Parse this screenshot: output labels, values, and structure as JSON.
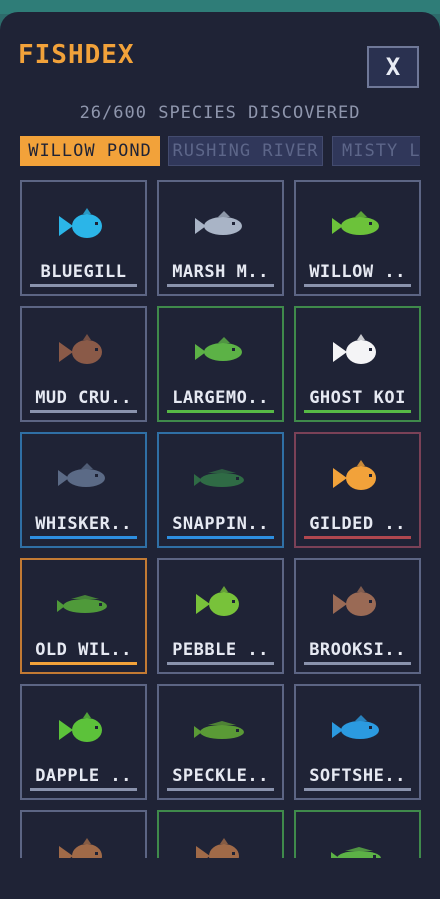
{
  "header": {
    "title": "FISHDEX",
    "close_label": "X"
  },
  "progress_text": "26/600 SPECIES DISCOVERED",
  "tabs": [
    {
      "label": "WILLOW POND",
      "active": true
    },
    {
      "label": "RUSHING RIVER",
      "active": false
    },
    {
      "label": "MISTY LA",
      "active": false
    }
  ],
  "colors": {
    "accent": "#f2a23a",
    "panel": "#1f2336",
    "common": "#8a93ad",
    "uncommon": "#56b845",
    "rare": "#2d8ee0",
    "epic": "#b0474f",
    "legendary": "#f2a23a"
  },
  "fish": [
    {
      "label": "BLUEGILL",
      "rarity": "common",
      "color": "#2bb5e8",
      "shape": "round"
    },
    {
      "label": "MARSH M..",
      "rarity": "common",
      "color": "#a9b4c6",
      "shape": "long"
    },
    {
      "label": "WILLOW ..",
      "rarity": "common",
      "color": "#6cc23a",
      "shape": "long"
    },
    {
      "label": "MUD CRU..",
      "rarity": "common",
      "color": "#8a5a48",
      "shape": "round"
    },
    {
      "label": "LARGEMO..",
      "rarity": "uncommon",
      "color": "#5cb246",
      "shape": "long"
    },
    {
      "label": "GHOST KOI",
      "rarity": "uncommon",
      "color": "#f4f4f6",
      "shape": "round"
    },
    {
      "label": "WHISKER..",
      "rarity": "rare",
      "color": "#5b6a86",
      "shape": "long"
    },
    {
      "label": "SNAPPIN..",
      "rarity": "rare",
      "color": "#2f6b45",
      "shape": "flat"
    },
    {
      "label": "GILDED ..",
      "rarity": "epic",
      "color": "#f2a23a",
      "shape": "round"
    },
    {
      "label": "OLD WIL..",
      "rarity": "legendary",
      "color": "#4f9a3a",
      "shape": "flat"
    },
    {
      "label": "PEBBLE ..",
      "rarity": "common",
      "color": "#78c23a",
      "shape": "round"
    },
    {
      "label": "BROOKSI..",
      "rarity": "common",
      "color": "#9a6a55",
      "shape": "round"
    },
    {
      "label": "DAPPLE ..",
      "rarity": "common",
      "color": "#5cc23a",
      "shape": "round"
    },
    {
      "label": "SPECKLE..",
      "rarity": "common",
      "color": "#5a9a36",
      "shape": "flat"
    },
    {
      "label": "SOFTSHE..",
      "rarity": "common",
      "color": "#2b9ae0",
      "shape": "long"
    },
    {
      "label": "",
      "rarity": "common",
      "color": "#a06a48",
      "shape": "round"
    },
    {
      "label": "",
      "rarity": "uncommon",
      "color": "#a06a48",
      "shape": "round"
    },
    {
      "label": "",
      "rarity": "uncommon",
      "color": "#5cb246",
      "shape": "flat"
    }
  ]
}
